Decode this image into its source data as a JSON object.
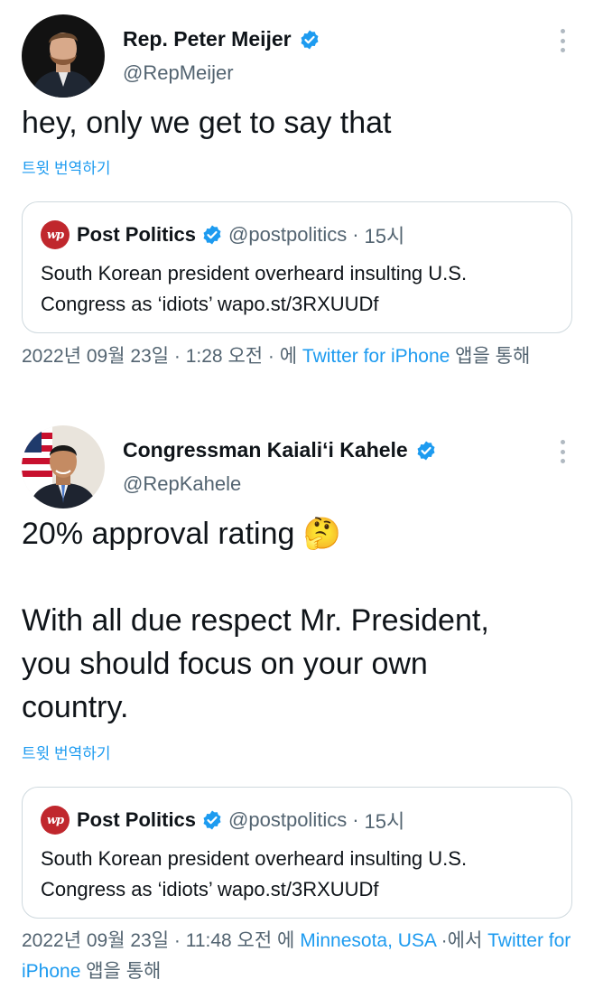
{
  "tweets": [
    {
      "display_name": "Rep. Peter Meijer",
      "handle": "@RepMeijer",
      "text": "hey, only we get to say that",
      "translate_label": "트윗 번역하기",
      "quote": {
        "name": "Post Politics",
        "handle": "@postpolitics",
        "separator": "·",
        "time": "15시",
        "text": "South Korean president overheard insulting U.S.\nCongress as ‘idiots’ wapo.st/3RXUUDf"
      },
      "meta": {
        "date": "2022년 09월 23일",
        "sep1": " · ",
        "time": "1:28 오전",
        "sep2": " · ",
        "via_prefix": "에 ",
        "source": "Twitter for iPhone",
        "suffix": " 앱을 통해"
      }
    },
    {
      "display_name": "Congressman Kaiali‘i Kahele",
      "handle": "@RepKahele",
      "text": "20% approval rating 🤔\n\nWith all due respect Mr. President,\nyou should focus on your own\ncountry.",
      "translate_label": "트윗 번역하기",
      "quote": {
        "name": "Post Politics",
        "handle": "@postpolitics",
        "separator": "·",
        "time": "15시",
        "text": "South Korean president overheard insulting U.S.\nCongress as ‘idiots’ wapo.st/3RXUUDf"
      },
      "meta": {
        "date": "2022년 09월 23일",
        "sep1": " · ",
        "time": "11:48 오전",
        "location_prefix": " 에 ",
        "location": "Minnesota, USA",
        "sep2": " ·에서 ",
        "source": "Twitter for iPhone",
        "suffix": " 앱을 통해"
      }
    }
  ],
  "icons": {
    "verified": "verified-badge-icon",
    "more": "more-options-icon",
    "wapo_logo": "wapo-logo",
    "wapo_logo_text": "wp"
  },
  "colors": {
    "accent": "#1d9bf0",
    "secondary_text": "#536471",
    "border": "#cfd9de",
    "wapo_red": "#c0272d"
  }
}
